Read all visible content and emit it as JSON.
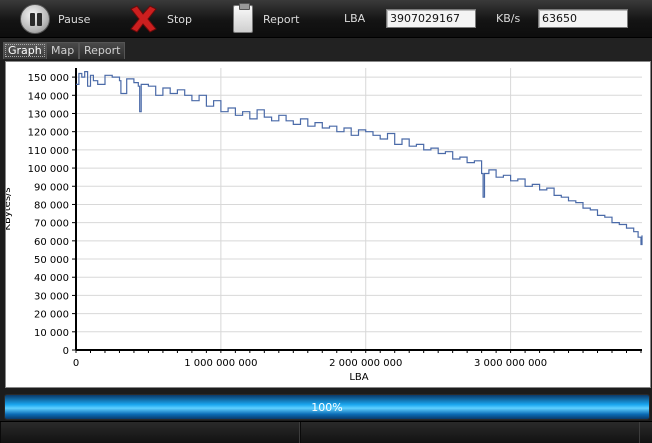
{
  "toolbar": {
    "pause_label": "Pause",
    "stop_label": "Stop",
    "report_label": "Report",
    "lba_label": "LBA",
    "lba_value": "3907029167",
    "kbs_label": "KB/s",
    "kbs_value": "63650"
  },
  "tabs": [
    {
      "label": "Graph",
      "active": true
    },
    {
      "label": "Map",
      "active": false
    },
    {
      "label": "Report",
      "active": false
    }
  ],
  "progress": {
    "value": 1.0,
    "label": "100%"
  },
  "colors": {
    "line": "#4a6aa8",
    "progress": "#1aa6ef",
    "grid": "#d8d8d8"
  },
  "chart_data": {
    "type": "line",
    "xlabel": "LBA",
    "ylabel": "KBytes/s",
    "xlim": [
      0,
      3907029167
    ],
    "ylim": [
      0,
      155000
    ],
    "grid": true,
    "xticks": [
      0,
      1000000000,
      2000000000,
      3000000000
    ],
    "xtick_labels": [
      "0",
      "1 000 000 000",
      "2 000 000 000",
      "3 000 000 000"
    ],
    "yticks": [
      0,
      10000,
      20000,
      30000,
      40000,
      50000,
      60000,
      70000,
      80000,
      90000,
      100000,
      110000,
      120000,
      130000,
      140000,
      150000
    ],
    "ytick_labels": [
      "0",
      "10 000",
      "20 000",
      "30 000",
      "40 000",
      "50 000",
      "60 000",
      "70 000",
      "80 000",
      "90 000",
      "100 000",
      "110 000",
      "120 000",
      "130 000",
      "140 000",
      "150 000"
    ],
    "series": [
      {
        "x": [
          0,
          20000000,
          40000000,
          60000000,
          80000000,
          100000000,
          120000000,
          150000000,
          200000000,
          250000000,
          300000000,
          310000000,
          350000000,
          400000000,
          430000000,
          440000000,
          450000000,
          500000000,
          550000000,
          600000000,
          650000000,
          700000000,
          750000000,
          800000000,
          850000000,
          900000000,
          950000000,
          1000000000,
          1050000000,
          1100000000,
          1150000000,
          1200000000,
          1250000000,
          1300000000,
          1350000000,
          1400000000,
          1450000000,
          1500000000,
          1550000000,
          1600000000,
          1650000000,
          1700000000,
          1750000000,
          1800000000,
          1850000000,
          1900000000,
          1950000000,
          2000000000,
          2050000000,
          2100000000,
          2150000000,
          2200000000,
          2250000000,
          2300000000,
          2350000000,
          2400000000,
          2450000000,
          2500000000,
          2550000000,
          2600000000,
          2650000000,
          2700000000,
          2750000000,
          2800000000,
          2810000000,
          2820000000,
          2850000000,
          2900000000,
          2950000000,
          3000000000,
          3050000000,
          3100000000,
          3150000000,
          3200000000,
          3250000000,
          3300000000,
          3350000000,
          3400000000,
          3450000000,
          3500000000,
          3550000000,
          3600000000,
          3650000000,
          3700000000,
          3750000000,
          3800000000,
          3850000000,
          3880000000,
          3900000000,
          3907029167
        ],
        "y": [
          146000,
          152000,
          150000,
          153000,
          145000,
          151000,
          148000,
          146000,
          151000,
          150000,
          148000,
          141000,
          149000,
          147000,
          145000,
          131000,
          146000,
          145000,
          140000,
          144000,
          141000,
          143000,
          140000,
          137000,
          140000,
          134000,
          137000,
          131000,
          133000,
          129000,
          131000,
          127000,
          132000,
          128000,
          126000,
          129000,
          126000,
          124000,
          127000,
          123000,
          125000,
          122000,
          123000,
          120000,
          122000,
          118000,
          121000,
          120000,
          118000,
          116000,
          119000,
          113000,
          116000,
          112000,
          113000,
          110000,
          111000,
          108000,
          109000,
          105000,
          106000,
          103000,
          104000,
          97000,
          84000,
          97000,
          99000,
          95000,
          96000,
          93000,
          94000,
          90000,
          91000,
          88000,
          89000,
          85000,
          84000,
          82000,
          81000,
          78000,
          77000,
          74000,
          73000,
          70000,
          69000,
          67000,
          65000,
          62000,
          58000,
          63000
        ]
      }
    ]
  }
}
